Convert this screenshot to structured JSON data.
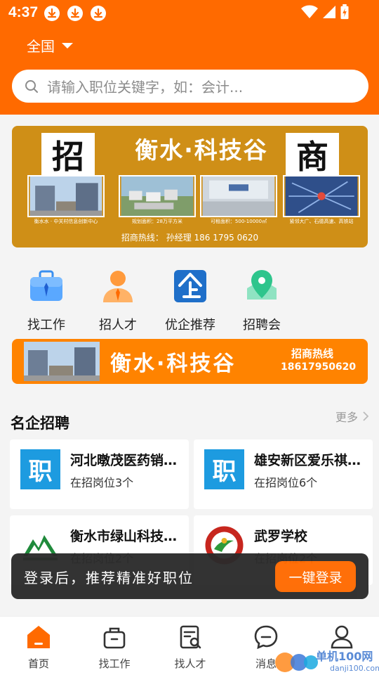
{
  "status_bar": {
    "time": "4:37"
  },
  "header": {
    "city": "全国",
    "search_placeholder": "请输入职位关键字，如：会计..."
  },
  "banner_main": {
    "left_char": "招",
    "right_char": "商",
    "title": "衡水·科技谷",
    "captions": [
      "衡水水 · 中关村信息创新中心",
      "规划面积：28万平方米",
      "可租面积：500-10000㎡",
      "紧邻大广、石德高速、高铁站"
    ],
    "hotline": "招商热线：  孙经理 186 1795 0620"
  },
  "categories": [
    {
      "label": "找工作",
      "icon": "briefcase-icon"
    },
    {
      "label": "招人才",
      "icon": "person-icon"
    },
    {
      "label": "优企推荐",
      "icon": "enterprise-icon"
    },
    {
      "label": "招聘会",
      "icon": "location-pin-icon"
    }
  ],
  "banner_secondary": {
    "title": "衡水·科技谷",
    "hotline_label": "招商热线",
    "hotline_number": "18617950620"
  },
  "section": {
    "title": "名企招聘",
    "more_label": "更多"
  },
  "companies": [
    {
      "name": "河北暾茂医药销售有限公司",
      "count": "在招岗位3个",
      "logo_char": "职"
    },
    {
      "name": "雄安新区爱乐祺教育科技",
      "count": "在招岗位6个",
      "logo_char": "职"
    },
    {
      "name": "衡水市绿山科技有限公司",
      "count": "在招岗位2个",
      "logo_char": ""
    },
    {
      "name": "武罗学校",
      "count": "在招岗位2个",
      "logo_char": ""
    }
  ],
  "toast": {
    "message": "登录后，推荐精准好职位",
    "button": "一键登录"
  },
  "tabs": [
    {
      "label": "首页",
      "icon": "home-icon"
    },
    {
      "label": "找工作",
      "icon": "bag-icon"
    },
    {
      "label": "找人才",
      "icon": "resume-search-icon"
    },
    {
      "label": "消息",
      "icon": "message-icon"
    },
    {
      "label": "",
      "icon": "profile-icon"
    }
  ],
  "watermark": {
    "text": "单机100网",
    "url": "danji100.com"
  },
  "colors": {
    "brand_orange": "#ff6a00",
    "banner_gold": "#cf8f17",
    "logo_blue": "#1d9be0"
  }
}
